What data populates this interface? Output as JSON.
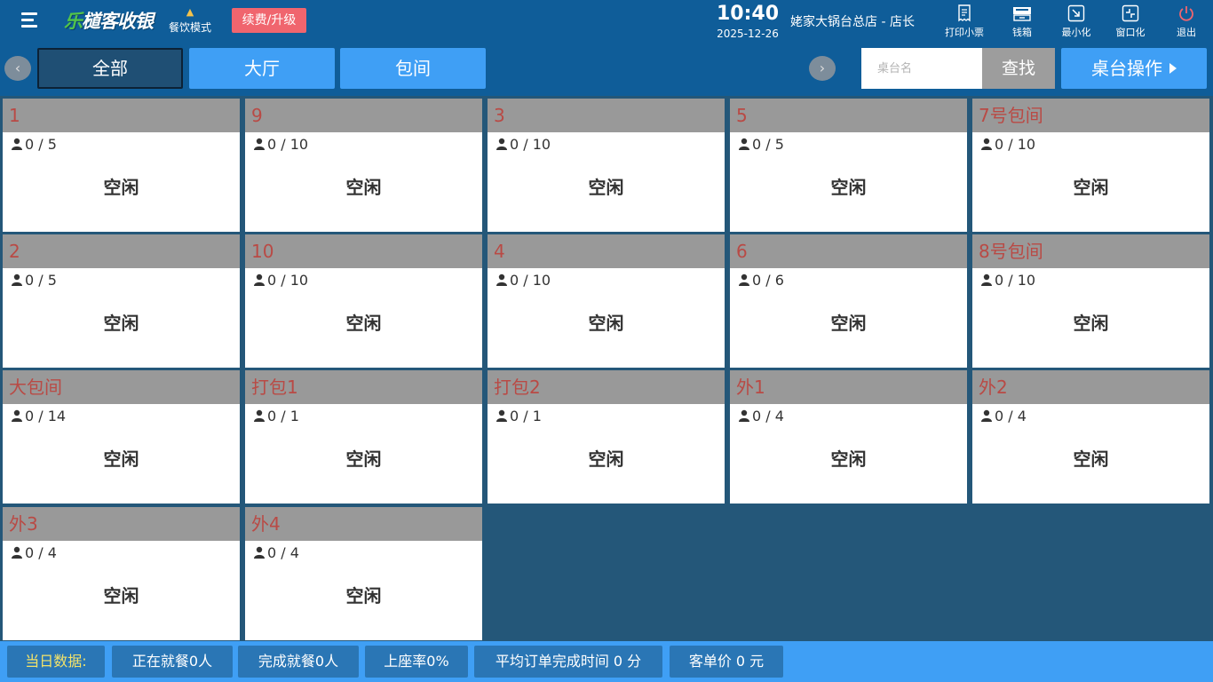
{
  "header": {
    "logo": {
      "part1": "乐",
      "part2": "檤客收银"
    },
    "mode_label": "餐饮模式",
    "renew_label": "续费/升级",
    "time": "10:40",
    "date": "2025-12-26",
    "store": "姥家大锅台总店 - 店长",
    "buttons": [
      {
        "label": "打印小票",
        "icon": "receipt-icon"
      },
      {
        "label": "钱箱",
        "icon": "cash-drawer-icon"
      },
      {
        "label": "最小化",
        "icon": "minimize-icon"
      },
      {
        "label": "窗口化",
        "icon": "window-icon"
      },
      {
        "label": "退出",
        "icon": "power-icon"
      }
    ]
  },
  "toolbar": {
    "tabs": [
      {
        "label": "全部",
        "active": true
      },
      {
        "label": "大厅",
        "active": false
      },
      {
        "label": "包间",
        "active": false
      }
    ],
    "search_placeholder": "桌台名",
    "search_button": "查找",
    "table_op_button": "桌台操作"
  },
  "tables": [
    {
      "name": "1",
      "seats": "0 / 5",
      "status": "空闲"
    },
    {
      "name": "9",
      "seats": "0 / 10",
      "status": "空闲"
    },
    {
      "name": "3",
      "seats": "0 / 10",
      "status": "空闲"
    },
    {
      "name": "5",
      "seats": "0 / 5",
      "status": "空闲"
    },
    {
      "name": "7号包间",
      "seats": "0 / 10",
      "status": "空闲"
    },
    {
      "name": "2",
      "seats": "0 / 5",
      "status": "空闲"
    },
    {
      "name": "10",
      "seats": "0 / 10",
      "status": "空闲"
    },
    {
      "name": "4",
      "seats": "0 / 10",
      "status": "空闲"
    },
    {
      "name": "6",
      "seats": "0 / 6",
      "status": "空闲"
    },
    {
      "name": "8号包间",
      "seats": "0 / 10",
      "status": "空闲"
    },
    {
      "name": "大包间",
      "seats": "0 / 14",
      "status": "空闲"
    },
    {
      "name": "打包1",
      "seats": "0 / 1",
      "status": "空闲"
    },
    {
      "name": "打包2",
      "seats": "0 / 1",
      "status": "空闲"
    },
    {
      "name": "外1",
      "seats": "0 / 4",
      "status": "空闲"
    },
    {
      "name": "外2",
      "seats": "0 / 4",
      "status": "空闲"
    },
    {
      "name": "外3",
      "seats": "0 / 4",
      "status": "空闲"
    },
    {
      "name": "外4",
      "seats": "0 / 4",
      "status": "空闲"
    }
  ],
  "footer": {
    "title": "当日数据:",
    "stats": [
      "正在就餐0人",
      "完成就餐0人",
      "上座率0%",
      "平均订单完成时间 0 分",
      "客单价 0 元"
    ]
  },
  "colors": {
    "header_bg": "#0f5d99",
    "tab_bg": "#3f9ff5",
    "card_head_bg": "#999999",
    "table_name": "#b94a45",
    "footer_bg": "#3f9ff5",
    "footer_title": "#f3e36a"
  }
}
